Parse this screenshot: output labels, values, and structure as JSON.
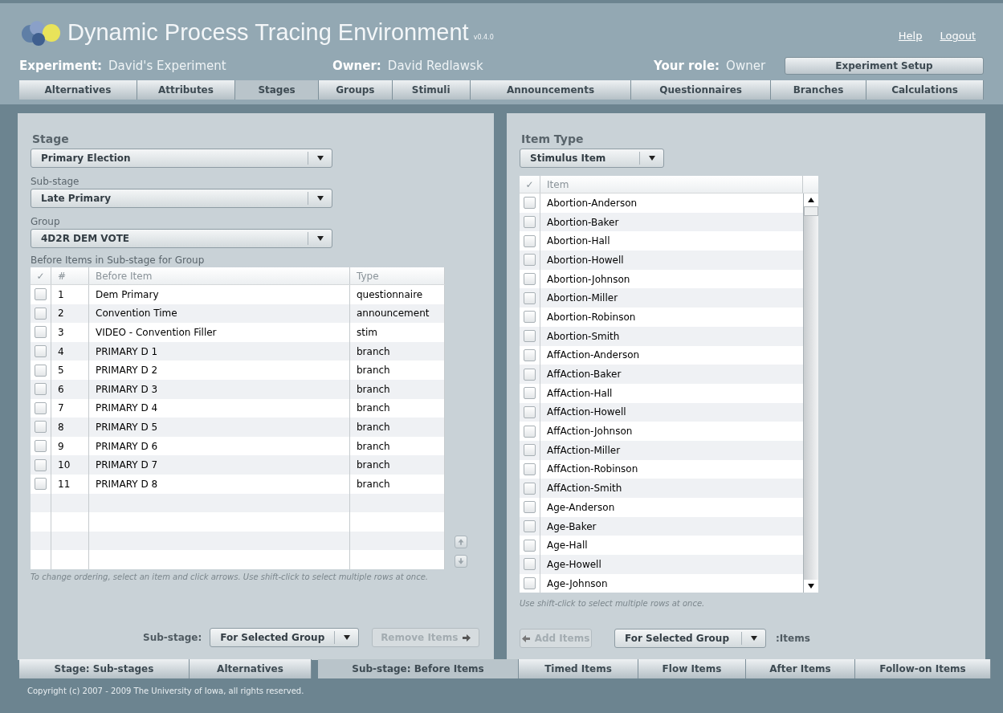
{
  "header": {
    "title": "Dynamic Process Tracing Environment",
    "version": "v0.4.0",
    "links": [
      "Help",
      "Logout"
    ],
    "info": [
      {
        "label": "Experiment:",
        "value": "David's Experiment"
      },
      {
        "label": "Owner:",
        "value": "David Redlawsk"
      },
      {
        "label": "Your role:",
        "value": "Owner"
      }
    ],
    "setup_button": "Experiment Setup",
    "tabs": [
      {
        "label": "Alternatives",
        "selected": false
      },
      {
        "label": "Attributes",
        "selected": false
      },
      {
        "label": "Stages",
        "selected": true
      },
      {
        "label": "Groups",
        "selected": false
      },
      {
        "label": "Stimuli",
        "selected": false
      },
      {
        "label": "Announcements",
        "selected": false
      },
      {
        "label": "Questionnaires",
        "selected": false
      },
      {
        "label": "Branches",
        "selected": false
      },
      {
        "label": "Calculations",
        "selected": false
      }
    ]
  },
  "left_panel": {
    "title": "Stage",
    "stage_select": "Primary Election",
    "substage_label": "Sub-stage",
    "substage_select": "Late Primary",
    "group_label": "Group",
    "group_select": "4D2R DEM VOTE",
    "table_caption": "Before Items in Sub-stage for Group",
    "columns": [
      "✓",
      "#",
      "Before Item",
      "Type"
    ],
    "rows": [
      {
        "number": "1",
        "item": "Dem Primary",
        "type": "questionnaire",
        "checked": false
      },
      {
        "number": "2",
        "item": "Convention Time",
        "type": "announcement",
        "checked": false
      },
      {
        "number": "3",
        "item": "VIDEO - Convention Filler",
        "type": "stim",
        "checked": false
      },
      {
        "number": "4",
        "item": "PRIMARY D 1",
        "type": "branch",
        "checked": false
      },
      {
        "number": "5",
        "item": "PRIMARY D 2",
        "type": "branch",
        "checked": false
      },
      {
        "number": "6",
        "item": "PRIMARY D 3",
        "type": "branch",
        "checked": false
      },
      {
        "number": "7",
        "item": "PRIMARY D 4",
        "type": "branch",
        "checked": false
      },
      {
        "number": "8",
        "item": "PRIMARY D 5",
        "type": "branch",
        "checked": false
      },
      {
        "number": "9",
        "item": "PRIMARY D 6",
        "type": "branch",
        "checked": false
      },
      {
        "number": "10",
        "item": "PRIMARY D 7",
        "type": "branch",
        "checked": false
      },
      {
        "number": "11",
        "item": "PRIMARY D 8",
        "type": "branch",
        "checked": false
      }
    ],
    "hint": "To change ordering, select an item and click arrows.  Use shift-click to select multiple rows at once.",
    "footer_label": "Sub-stage:",
    "footer_select": "For Selected Group",
    "remove_button": {
      "label": "Remove Items",
      "disabled": true
    }
  },
  "right_panel": {
    "title": "Item Type",
    "type_select": "Stimulus Item",
    "columns": [
      "✓",
      "Item"
    ],
    "rows": [
      {
        "item": "Abortion-Anderson",
        "checked": false
      },
      {
        "item": "Abortion-Baker",
        "checked": false
      },
      {
        "item": "Abortion-Hall",
        "checked": false
      },
      {
        "item": "Abortion-Howell",
        "checked": false
      },
      {
        "item": "Abortion-Johnson",
        "checked": false
      },
      {
        "item": "Abortion-Miller",
        "checked": false
      },
      {
        "item": "Abortion-Robinson",
        "checked": false
      },
      {
        "item": "Abortion-Smith",
        "checked": false
      },
      {
        "item": "AffAction-Anderson",
        "checked": false
      },
      {
        "item": "AffAction-Baker",
        "checked": false
      },
      {
        "item": "AffAction-Hall",
        "checked": false
      },
      {
        "item": "AffAction-Howell",
        "checked": false
      },
      {
        "item": "AffAction-Johnson",
        "checked": false
      },
      {
        "item": "AffAction-Miller",
        "checked": false
      },
      {
        "item": "AffAction-Robinson",
        "checked": false
      },
      {
        "item": "AffAction-Smith",
        "checked": false
      },
      {
        "item": "Age-Anderson",
        "checked": false
      },
      {
        "item": "Age-Baker",
        "checked": false
      },
      {
        "item": "Age-Hall",
        "checked": false
      },
      {
        "item": "Age-Howell",
        "checked": false
      },
      {
        "item": "Age-Johnson",
        "checked": false
      }
    ],
    "hint": "Use shift-click to select multiple rows at once.",
    "add_button": {
      "label": "Add Items",
      "disabled": true
    },
    "footer_select": "For Selected Group",
    "footer_suffix": ":Items"
  },
  "bottom_tabs": [
    [
      {
        "label": "Stage:  Sub-stages",
        "selected": false
      },
      {
        "label": "Alternatives",
        "selected": false
      }
    ],
    [
      {
        "label": "Sub-stage:  Before Items",
        "selected": true
      },
      {
        "label": "Timed Items",
        "selected": false
      },
      {
        "label": "Flow Items",
        "selected": false
      },
      {
        "label": "After Items",
        "selected": false
      },
      {
        "label": "Follow-on Items",
        "selected": false
      }
    ]
  ],
  "copyright": "Copyright (c) 2007 - 2009 The University of Iowa, all rights reserved."
}
